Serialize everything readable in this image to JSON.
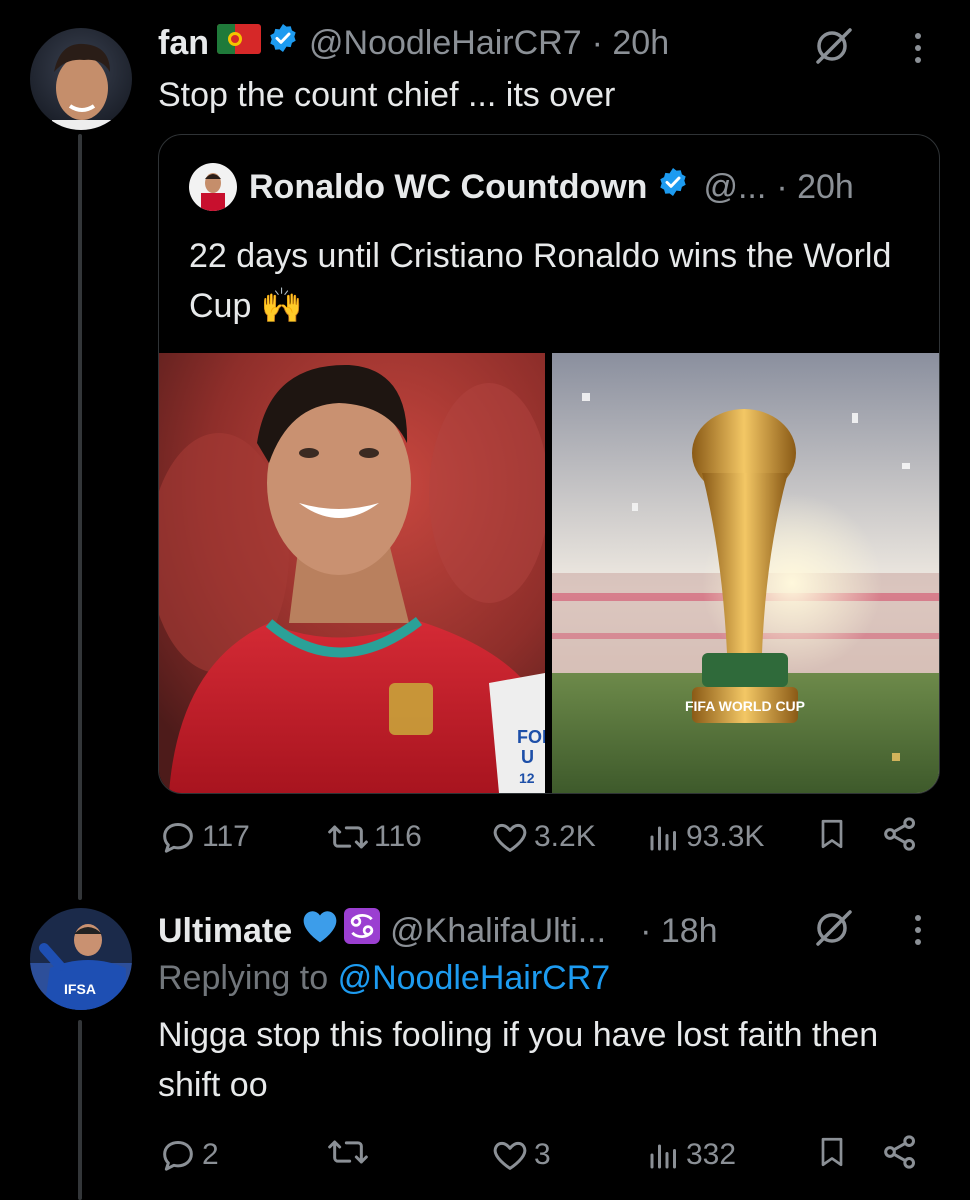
{
  "tweets": [
    {
      "name": "fan",
      "emoji": "🇵🇹",
      "verified": true,
      "handle": "@NoodleHairCR7",
      "time": "· 20h",
      "text": "Stop the count chief ... its over",
      "quote": {
        "name": "Ronaldo WC Countdown",
        "verified": true,
        "handle": "@...",
        "time": "· 20h",
        "text": "22 days until Cristiano Ronaldo wins the World Cup 🙌",
        "media": [
          {
            "icon": "ronaldo-photo",
            "overlay_text": [
              "FOR",
              "U",
              "12"
            ]
          },
          {
            "icon": "world-cup-trophy-photo",
            "overlay_text": "FIFA WORLD CUP"
          }
        ]
      },
      "stats": {
        "replies": "117",
        "reposts": "116",
        "likes": "3.2K",
        "views": "93.3K"
      }
    },
    {
      "name": "Ultimate",
      "emoji": "💙♋",
      "verified": false,
      "handle": "@KhalifaUlti...",
      "time": "· 18h",
      "replying_label": "Replying to",
      "replying_handle": "@NoodleHairCR7",
      "text": "Nigga stop this fooling if you have lost faith then shift oo",
      "avatar_text": "IFSA",
      "stats": {
        "replies": "2",
        "reposts": "",
        "likes": "3",
        "views": "332"
      }
    }
  ],
  "colors": {
    "background": "#000000",
    "muted": "#71767b",
    "link": "#1d9bf0",
    "verified": "#1d9bf0",
    "border": "#2f3336"
  },
  "icons": [
    "grok-icon",
    "more-icon",
    "reply-icon",
    "repost-icon",
    "like-icon",
    "views-icon",
    "bookmark-icon",
    "share-icon"
  ]
}
